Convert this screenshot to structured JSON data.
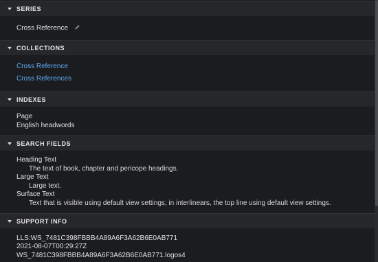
{
  "sections": {
    "series": {
      "title": "SERIES",
      "value": "Cross Reference"
    },
    "collections": {
      "title": "COLLECTIONS",
      "items": [
        "Cross Reference",
        "Cross References"
      ]
    },
    "indexes": {
      "title": "INDEXES",
      "items": [
        "Page",
        "English headwords"
      ]
    },
    "search_fields": {
      "title": "SEARCH FIELDS",
      "fields": [
        {
          "name": "Heading Text",
          "description": "The text of book, chapter and pericope headings."
        },
        {
          "name": "Large Text",
          "description": "Large text."
        },
        {
          "name": "Surface Text",
          "description": "Text that is visible using default view settings; in interlinears, the top line using default view settings."
        }
      ]
    },
    "support_info": {
      "title": "SUPPORT INFO",
      "lines": [
        "LLS:WS_7481C398FBBB4A89A6F3A62B6E0AB771",
        "2021-08-07T00:29:27Z",
        "WS_7481C398FBBB4A89A6F3A62B6E0AB771.logos4"
      ]
    }
  },
  "icons": {
    "section_toggle": "chevron-down-icon",
    "edit": "pencil-icon"
  },
  "colors": {
    "background": "#1b1c1f",
    "header_background": "#26272b",
    "link": "#5ea8f0",
    "text": "#e0e0e0"
  }
}
